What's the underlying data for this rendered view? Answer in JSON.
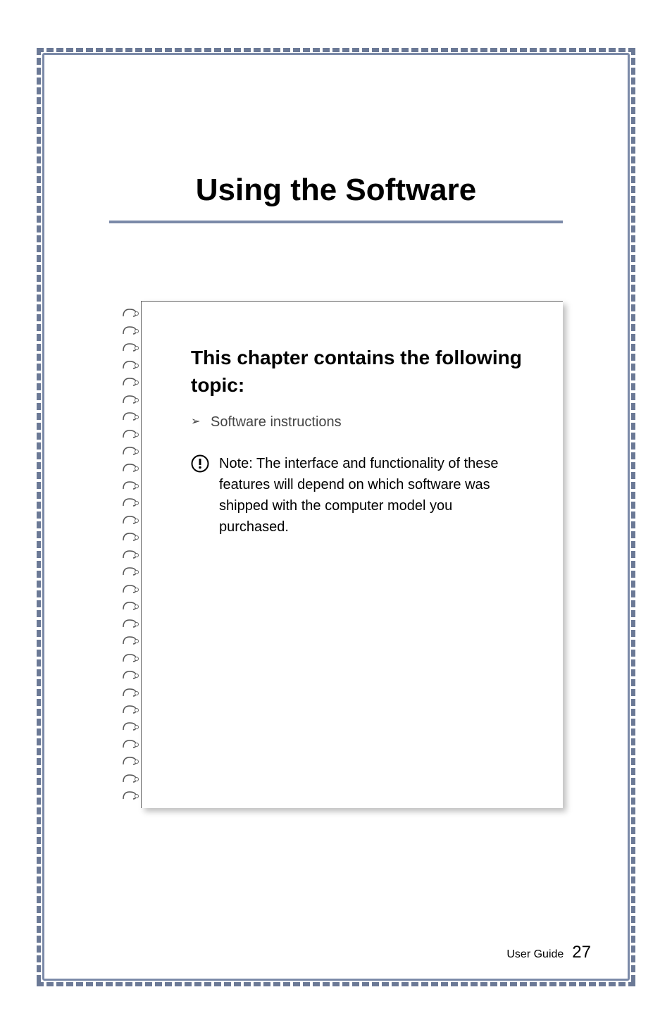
{
  "chapter": {
    "title": "Using the Software"
  },
  "topic_box": {
    "heading": "This chapter contains the following topic:",
    "list_items": [
      "Software instructions"
    ],
    "note": {
      "label": "Note:",
      "text": " The interface and functionality of these features will depend on which software was shipped with the computer model you purchased."
    }
  },
  "footer": {
    "label": "User Guide",
    "page_number": "27"
  }
}
